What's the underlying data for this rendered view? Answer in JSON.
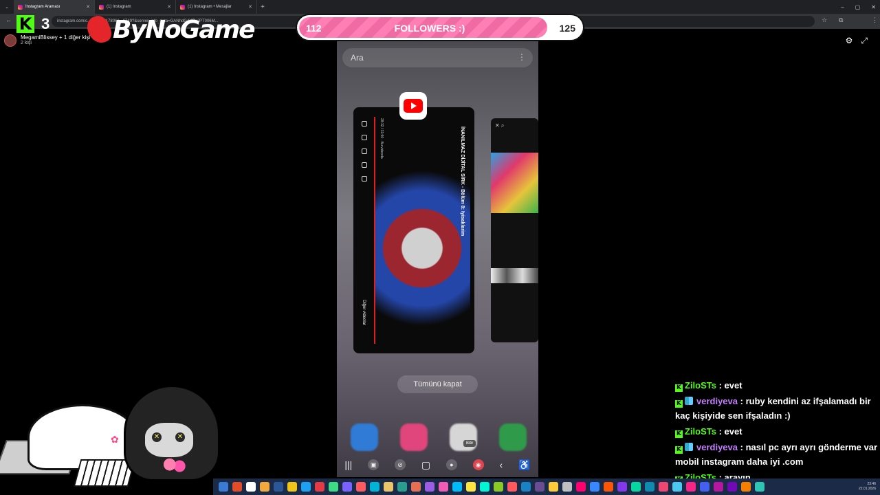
{
  "browser": {
    "tabs": [
      {
        "label": "Instagram Araması",
        "active": true
      },
      {
        "label": "(1) Instagram",
        "active": false
      },
      {
        "label": "(1) Instagram • Mesajlar",
        "active": false
      }
    ],
    "url": "instagram.com/c...ride.../...178061...6749?&server_info_data=GANhdG4YFVJPT006M..."
  },
  "overlay": {
    "kick_count": "3",
    "sponsor": "ByNoGame",
    "followers_goal": {
      "current": 112,
      "target": 125,
      "label": "FOLLOWERS :)",
      "fill_fraction": 0.88
    },
    "viewer_line": "MegamiBlissey + 1 diğer kişi",
    "viewer_count": "2 kişi"
  },
  "phone": {
    "search_placeholder": "Ara",
    "youtube_card": {
      "title": "İNANILMAZ DİJİTAL SİRK - Bölüm 8: Iyisaklarim",
      "meta": "28:32 / 31:50 · Bu videoda",
      "other_videos": "Diğer videolar"
    },
    "close_all_label": "Tümünü kapat",
    "tooltip": "Bitir"
  },
  "chat": [
    {
      "user": "ZiloSTs",
      "text": "evet",
      "color": "#53fc18",
      "sub_badge": false
    },
    {
      "user": "verdiyeva",
      "text": "ruby kendini az ifşalamadı bir kaç kişiyide sen ifşaladın :)",
      "color": "#c77dff",
      "sub_badge": true
    },
    {
      "user": "ZiloSTs",
      "text": "evet",
      "color": "#53fc18",
      "sub_badge": false
    },
    {
      "user": "verdiyeva",
      "text": "nasıl pc ayrı ayrı gönderme var mobil instagram daha iyi .com",
      "color": "#c77dff",
      "sub_badge": true
    },
    {
      "user": "ZiloSTs",
      "text": "arayın",
      "color": "#53fc18",
      "sub_badge": false
    }
  ],
  "taskbar": {
    "time": "23:46",
    "date": "22.01.2026"
  },
  "icons": {
    "settings": "gear-icon",
    "fullscreen": "expand-icon"
  },
  "colors": {
    "kick_green": "#53fc18",
    "progress_pink": "#f06aa3",
    "youtube_red": "#ff0000"
  }
}
